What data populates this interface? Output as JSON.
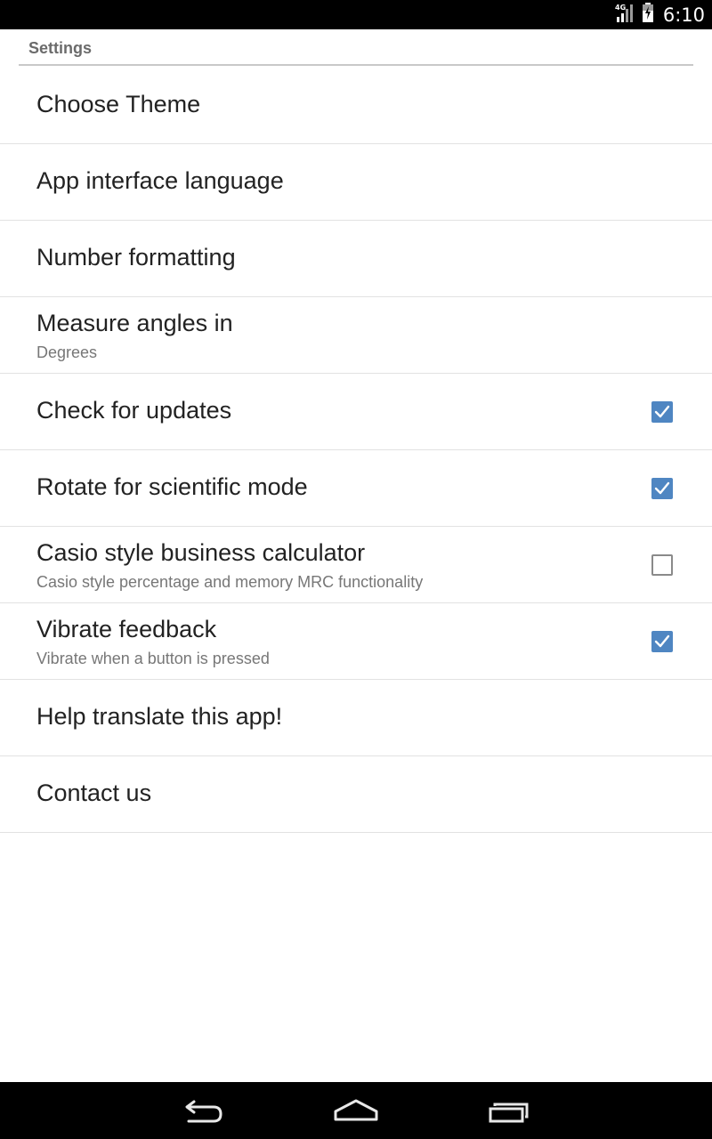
{
  "status_bar": {
    "network": "4G",
    "time": "6:10"
  },
  "header": {
    "title": "Settings"
  },
  "preferences": [
    {
      "title": "Choose Theme"
    },
    {
      "title": "App interface language"
    },
    {
      "title": "Number formatting"
    },
    {
      "title": "Measure angles in",
      "summary": "Degrees"
    },
    {
      "title": "Check for updates",
      "checked": true
    },
    {
      "title": "Rotate for scientific mode",
      "checked": true
    },
    {
      "title": "Casio style business calculator",
      "summary": "Casio style percentage and memory MRC functionality",
      "checked": false
    },
    {
      "title": "Vibrate feedback",
      "summary": "Vibrate when a button is pressed",
      "checked": true
    },
    {
      "title": "Help translate this app!"
    },
    {
      "title": "Contact us"
    }
  ],
  "nav_bar": {
    "icons": [
      "back-icon",
      "home-icon",
      "recent-apps-icon"
    ]
  },
  "colors": {
    "accent": "#4f86c2",
    "status_bar": "#000000",
    "header_text": "#6b6b6b",
    "divider": "#e2e2e2"
  }
}
